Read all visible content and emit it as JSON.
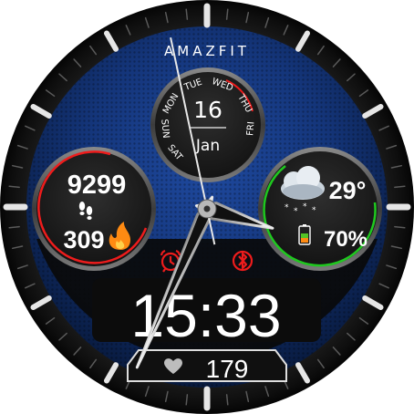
{
  "brand": "AMAZFIT",
  "date": {
    "day": "16",
    "month": "Jan",
    "weekdays": [
      "SAT",
      "SUN",
      "MON",
      "TUE",
      "WED",
      "THU",
      "FRI"
    ],
    "current_weekday": "MON"
  },
  "activity": {
    "steps": "9299",
    "calories": "309",
    "steps_icon": "footsteps-icon",
    "calories_icon": "flame-icon"
  },
  "weather": {
    "temperature": "29°",
    "icon": "snow-cloud-icon"
  },
  "battery": {
    "percent": "70%",
    "level": 0.7,
    "icon": "battery-icon"
  },
  "status_icons": [
    "alarm-clock-icon",
    "bluetooth-icon"
  ],
  "time": "15:33",
  "heart_rate": {
    "value": "179",
    "icon": "heart-icon"
  },
  "hands": {
    "hour": 15,
    "minute": 33,
    "second": 58
  },
  "colors": {
    "accent_red": "#ee1c1c",
    "ring_green": "#1fc81f",
    "flame_orange": "#ff8a12",
    "battery_green": "#53c426",
    "battery_orange": "#ff8a12",
    "dial_blue": "#14357a"
  }
}
